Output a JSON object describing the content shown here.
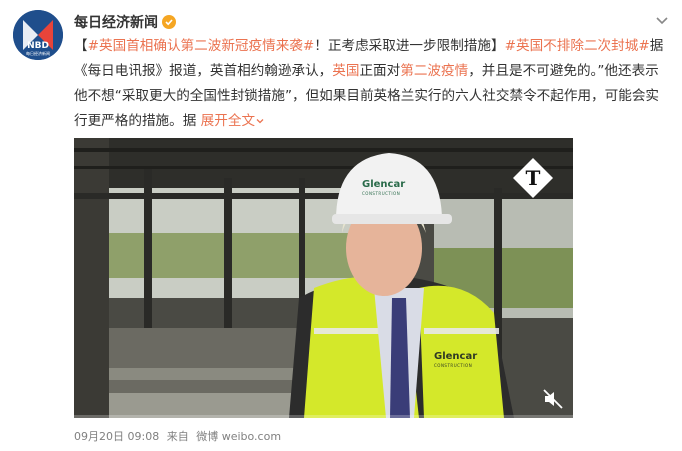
{
  "author": {
    "name": "每日经济新闻",
    "avatar_text": "NBD",
    "avatar_subtext": "每日经济新闻"
  },
  "post": {
    "segments": [
      {
        "t": "【",
        "c": "plain"
      },
      {
        "t": "#英国首相确认第二波新冠疫情来袭#",
        "c": "hl"
      },
      {
        "t": "！正考虑采取进一步限制措施】",
        "c": "plain"
      },
      {
        "t": "#英国不排除二次封城#",
        "c": "hl"
      },
      {
        "t": "据《每日电讯报》报道，英首相约翰逊承认，",
        "c": "plain"
      },
      {
        "t": "英国",
        "c": "hl"
      },
      {
        "t": "正面对",
        "c": "plain"
      },
      {
        "t": "第二波疫情",
        "c": "hl"
      },
      {
        "t": "，并且是不可避免的。”他还表示他不想“采取更大的全国性封锁措施”，但如果目前英格兰实行的六人社交禁令不起作用，可能会实行更严格的措施。据 ",
        "c": "plain"
      }
    ],
    "expand_label": "展开全文"
  },
  "video": {
    "hat_text": "Glencar",
    "hat_subtext": "CONSTRUCTION",
    "vest_text": "Glencar",
    "vest_subtext": "CONSTRUCTION",
    "progress_percent": 0
  },
  "meta": {
    "date": "09月20日 09:08",
    "source_prefix": "来自",
    "source": "微博 weibo.com"
  },
  "colors": {
    "accent": "#eb7350",
    "meta": "#808080",
    "verified": "#f5a623"
  }
}
